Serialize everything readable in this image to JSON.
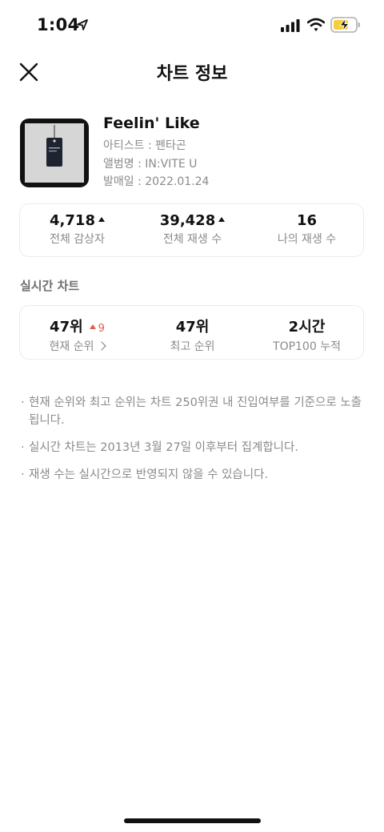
{
  "status_bar": {
    "time": "1:04"
  },
  "header": {
    "title": "차트 정보"
  },
  "track": {
    "title": "Feelin' Like",
    "artist": "아티스트 : 펜타곤",
    "album": "앨범명 : IN:VITE U",
    "release": "발매일 : 2022.01.24"
  },
  "stats": [
    {
      "value": "4,718",
      "label": "전체 감상자",
      "trend": "up"
    },
    {
      "value": "39,428",
      "label": "전체 재생 수",
      "trend": "up"
    },
    {
      "value": "16",
      "label": "나의 재생 수"
    }
  ],
  "realtime": {
    "section_title": "실시간 차트",
    "current_rank": {
      "value": "47위",
      "change": "9",
      "label": "현재 순위"
    },
    "best_rank": {
      "value": "47위",
      "label": "최고 순위"
    },
    "top100": {
      "value": "2시간",
      "label": "TOP100 누적"
    }
  },
  "notes": [
    "현재 순위와 최고 순위는 차트 250위권 내 진입여부를 기준으로 노출됩니다.",
    "실시간 차트는 2013년 3월 27일 이후부터 집계합니다.",
    "재생 수는 실시간으로 반영되지 않을 수 있습니다."
  ],
  "colors": {
    "rank_up": "#e25c4e",
    "muted_text": "#8a8a8a"
  }
}
